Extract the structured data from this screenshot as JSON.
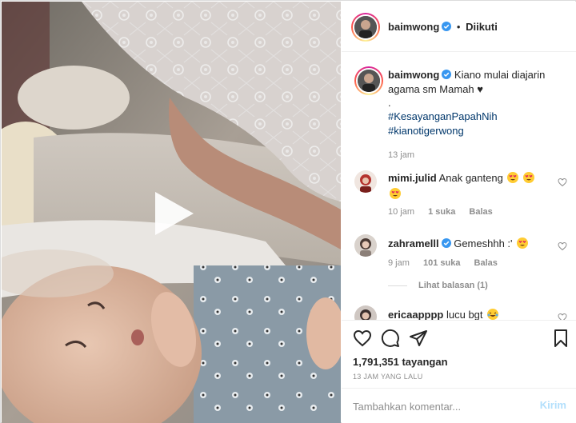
{
  "post": {
    "username": "baimwong",
    "dot": "•",
    "follow_status": "Diikuti"
  },
  "caption": {
    "username": "baimwong",
    "text": "Kiano mulai diajarin agama sm Mamah",
    "heart": "♥",
    "dot_line": ".",
    "hashtags": [
      "#KesayanganPapahNih",
      "#kianotigerwong"
    ],
    "time": "13 jam"
  },
  "comments": [
    {
      "username": "mimi.julid",
      "text": "Anak ganteng",
      "emoji": "heart-eyes-emoji",
      "time": "10 jam",
      "likes": "1 suka",
      "reply": "Balas"
    },
    {
      "username": "zahramelll",
      "text": "Gemeshhh :'",
      "emoji": "heart-eyes-emoji",
      "time": "9 jam",
      "likes": "101 suka",
      "reply": "Balas",
      "view_replies": "Lihat balasan (1)"
    },
    {
      "username": "ericaapppp",
      "text": "lucu bgt",
      "emoji": "crying-laughing-emoji"
    }
  ],
  "actions": {
    "views": "1,791,351 tayangan",
    "posted_ago": "13 JAM YANG LALU"
  },
  "comment_box": {
    "placeholder": "Tambahkan komentar...",
    "post_label": "Kirim"
  },
  "colors": {
    "link": "#00376b",
    "verified": "#3897f0",
    "muted": "#8e8e8e",
    "post_disabled": "#b2dffc"
  }
}
